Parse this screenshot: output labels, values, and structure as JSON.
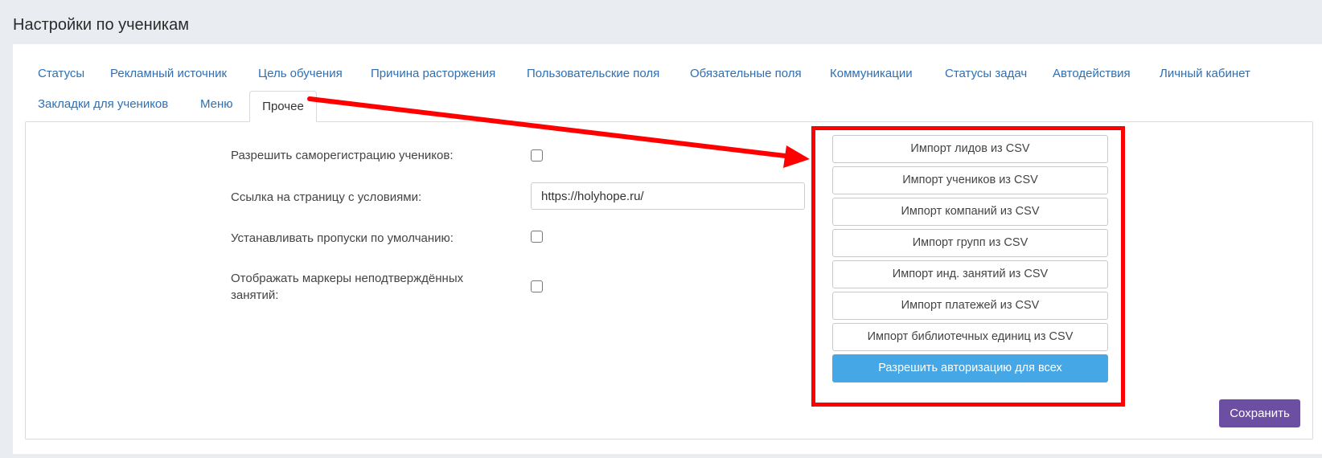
{
  "page": {
    "title": "Настройки по ученикам"
  },
  "tabs": [
    {
      "label": "Статусы"
    },
    {
      "label": "Рекламный источник"
    },
    {
      "label": "Цель обучения"
    },
    {
      "label": "Причина расторжения"
    },
    {
      "label": "Пользовательские поля"
    },
    {
      "label": "Обязательные поля"
    },
    {
      "label": "Коммуникации"
    },
    {
      "label": "Статусы задач"
    },
    {
      "label": "Автодействия"
    },
    {
      "label": "Личный кабинет"
    },
    {
      "label": "Закладки для учеников"
    },
    {
      "label": "Меню"
    },
    {
      "label": "Прочее",
      "active": true
    }
  ],
  "form": {
    "self_registration_label": "Разрешить саморегистрацию учеников:",
    "self_registration_checked": false,
    "terms_link_label": "Ссылка на страницу с условиями:",
    "terms_link_value": "https://holyhope.ru/",
    "default_absences_label": "Устанавливать пропуски по умолчанию:",
    "default_absences_checked": false,
    "unconfirmed_markers_label": "Отображать маркеры неподтверждённых занятий:",
    "unconfirmed_markers_checked": false
  },
  "imports": [
    {
      "label": "Импорт лидов из CSV"
    },
    {
      "label": "Импорт учеников из CSV"
    },
    {
      "label": "Импорт компаний из CSV"
    },
    {
      "label": "Импорт групп из CSV"
    },
    {
      "label": "Импорт инд. занятий из CSV"
    },
    {
      "label": "Импорт платежей из CSV"
    },
    {
      "label": "Импорт библиотечных единиц из CSV"
    }
  ],
  "actions": {
    "allow_auth_label": "Разрешить авторизацию для всех",
    "save_label": "Сохранить"
  },
  "colors": {
    "link": "#2f6fb2",
    "primary": "#46a7e6",
    "save": "#6c4fa2",
    "annotation": "#ff0000"
  }
}
